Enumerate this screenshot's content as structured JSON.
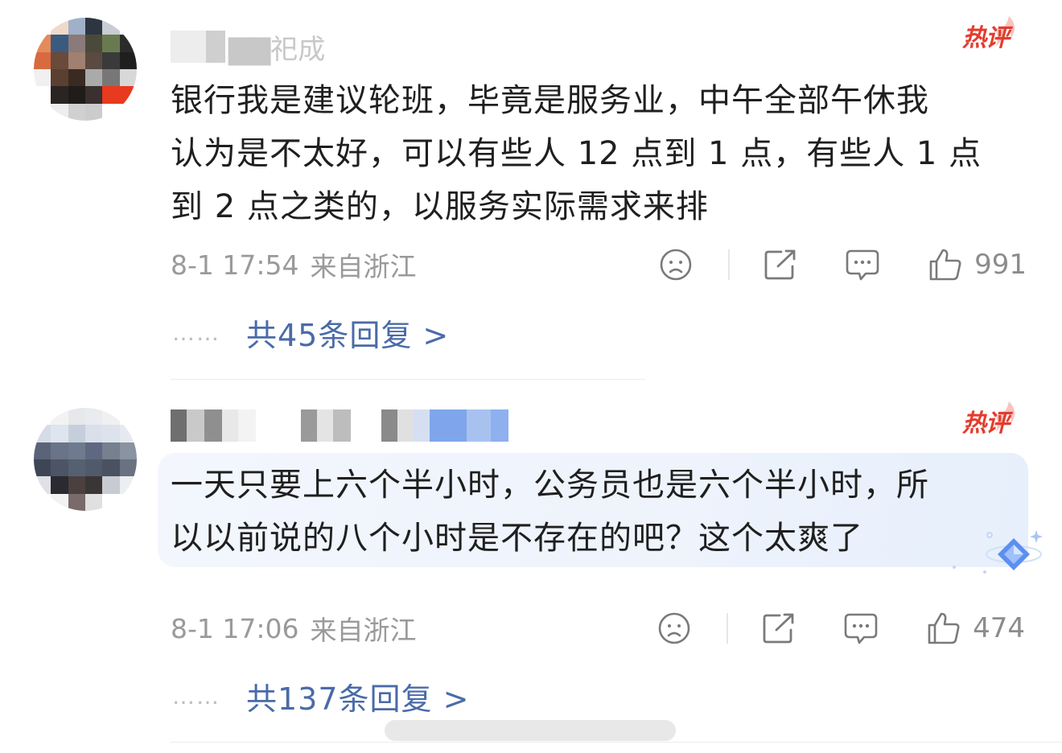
{
  "comments": [
    {
      "username": "▇▇祀成",
      "hot_label": "热评",
      "content_lines": [
        "银行我是建议轮班，毕竟是服务业，中午全部午休我",
        "认为是不太好，可以有些人 12 点到 1 点，有些人 1 点",
        "到 2 点之类的，以服务实际需求来排"
      ],
      "timestamp": "8-1 17:54",
      "location": "来自浙江",
      "like_count": "991",
      "dots": "……",
      "reply_link": "共45条回复 >"
    },
    {
      "username": "",
      "hot_label": "热评",
      "content_lines": [
        "一天只要上六个半小时，公务员也是六个半小时，所",
        "以以前说的八个小时是不存在的吧？这个太爽了"
      ],
      "timestamp": "8-1 17:06",
      "location": "来自浙江",
      "like_count": "474",
      "dots": "……",
      "reply_link": "共137条回复 >"
    }
  ],
  "icons": {
    "reaction": "sad-face-icon",
    "share": "share-icon",
    "comment": "comment-bubble-icon",
    "like": "thumbs-up-icon"
  },
  "colors": {
    "hot_red": "#e33c2e",
    "reply_blue": "#4a6ba8",
    "meta_gray": "#9a9a9a"
  }
}
